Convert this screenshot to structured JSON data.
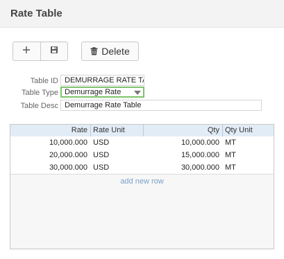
{
  "header": {
    "title": "Rate Table"
  },
  "toolbar": {
    "add_icon": "plus-icon",
    "save_icon": "floppy-disk-icon",
    "delete_label": "Delete",
    "delete_icon": "trash-icon"
  },
  "form": {
    "table_id_label": "Table ID",
    "table_id_value": "DEMURRAGE RATE TABLE",
    "table_type_label": "Table Type",
    "table_type_value": "Demurrage Rate",
    "table_desc_label": "Table Desc",
    "table_desc_value": "Demurrage Rate Table"
  },
  "grid": {
    "columns": [
      "Rate",
      "Rate Unit",
      "Qty",
      "Qty Unit"
    ],
    "rows": [
      [
        "10,000.000",
        "USD",
        "10,000.000",
        "MT"
      ],
      [
        "20,000.000",
        "USD",
        "15,000.000",
        "MT"
      ],
      [
        "30,000.000",
        "USD",
        "30,000.000",
        "MT"
      ]
    ],
    "add_row_label": "add new row"
  },
  "colors": {
    "accent_green": "#7dc46b",
    "header_blue": "#e2ecf7",
    "link_blue": "#7aa0c8"
  }
}
